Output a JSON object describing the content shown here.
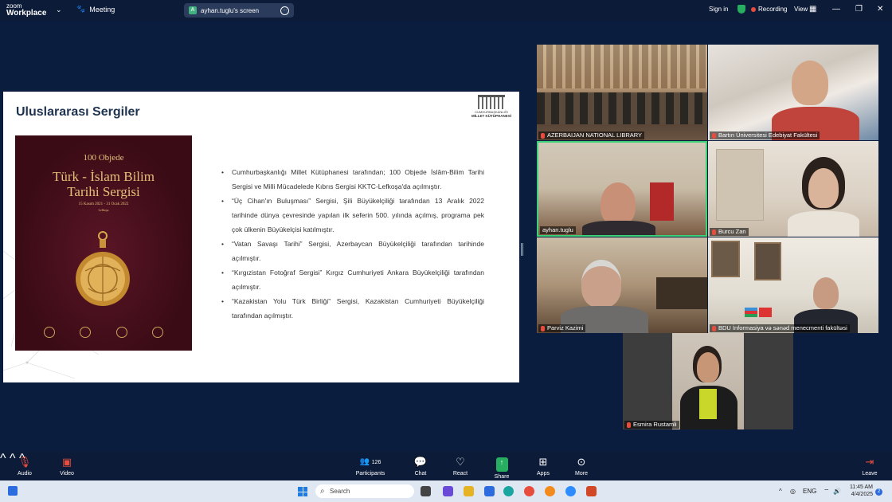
{
  "app": {
    "logo_line1": "zoom",
    "logo_line2": "Workplace",
    "meeting_tab": "Meeting",
    "screen_share_label": "ayhan.tuglu's screen",
    "screen_share_initial": "A",
    "sign_in": "Sign in",
    "recording": "Recording",
    "view": "View"
  },
  "slide": {
    "title": "Uluslararası Sergiler",
    "logo_line1": "CUMHURBAŞKANLIĞI",
    "logo_line2": "MİLLET KÜTÜPHANESİ",
    "poster": {
      "line1": "100 Objede",
      "line2": "Türk - İslam Bilim",
      "line3": "Tarihi Sergisi",
      "dates": "15 Kasım 2021 - 31 Ocak 2022",
      "place": "Lefkoşa"
    },
    "bullets": [
      "Cumhurbaşkanlığı Millet Kütüphanesi tarafından; 100 Objede İslâm-Bilim Tarihi Sergisi ve Milli Mücadelede Kıbrıs Sergisi KKTC-Lefkoşa'da açılmıştır.",
      "“Üç Cihan'ın Buluşması” Sergisi, Şili Büyükelçiliği tarafından 13 Aralık 2022 tarihinde dünya çevresinde yapılan ilk seferin 500. yılında açılmış, programa pek çok ülkenin Büyükelçisi katılmıştır.",
      "“Vatan Savaşı Tarihi” Sergisi, Azerbaycan Büyükelçiliği tarafından tarihinde açılmıştır.",
      "“Kırgızistan Fotoğraf Sergisi” Kırgız Cumhuriyeti Ankara Büyükelçiliği tarafından açılmıştır.",
      "“Kazakistan Yolu Türk Birliği” Sergisi, Kazakistan Cumhuriyeti Büyükelçiliği tarafından açılmıştır."
    ]
  },
  "participants_tiles": [
    {
      "name": "AZERBAIJAN NATIONAL LIBRARY"
    },
    {
      "name": "Bartın Üniversitesi Edebiyat Fakültesi"
    },
    {
      "name": "ayhan.tuglu"
    },
    {
      "name": "Burcu Zan"
    },
    {
      "name": "Parviz Kazimi"
    },
    {
      "name": "BDU İnformasiya və sənəd menecmenti fakültəsi"
    },
    {
      "name": "Esmira Rustamli"
    }
  ],
  "toolbar": {
    "audio": "Audio",
    "video": "Video",
    "participants": "Participants",
    "participants_count": "126",
    "chat": "Chat",
    "react": "React",
    "share": "Share",
    "apps": "Apps",
    "more": "More",
    "leave": "Leave"
  },
  "taskbar": {
    "search_placeholder": "Search",
    "language": "ENG",
    "time": "11:45 AM",
    "date": "4/4/2025",
    "notification_count": "2"
  }
}
